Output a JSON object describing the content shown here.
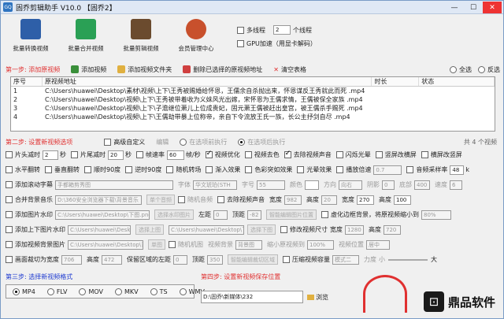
{
  "window": {
    "title": "固乔剪辑助手 V10.0 【固乔2】"
  },
  "toolbar": {
    "items": [
      {
        "label": "批量转换视频",
        "icon": "convert-video-icon",
        "color": "#2e5fa8"
      },
      {
        "label": "批量合并视频",
        "icon": "merge-video-icon",
        "color": "#2aa055"
      },
      {
        "label": "批量剪辑视频",
        "icon": "edit-video-icon",
        "color": "#6b4b2e"
      },
      {
        "label": "会员管理中心",
        "icon": "member-center-icon",
        "color": "#c8502c"
      }
    ],
    "multithread_label": "多线程",
    "multithread_value": "2",
    "threads_suffix": "个线程",
    "gpu_label": "GPU加速",
    "gpu_hint": "（用显卡解码）"
  },
  "step1": {
    "title": "第一步: 添加原视频",
    "add_video": "添加视频",
    "add_folder": "添加视频文件夹",
    "delete_selected": "删除已选择的原视频地址",
    "clear_table": "清空表格",
    "select_all": "全选",
    "invert": "反选"
  },
  "table": {
    "headers": [
      "序号",
      "原视频地址",
      "时长",
      "状态"
    ],
    "rows": [
      {
        "no": "1",
        "path": "C:\\Users\\huawei\\Desktop\\素材\\视频\\上下\\王秀被赐婚给怀恩，王儒余自杀抛出来，怀恩谋反王秀就此而死 .mp4"
      },
      {
        "no": "2",
        "path": "C:\\Users\\huawei\\Desktop\\视频\\上下\\王秀被带着收为义妹风光出嫁，宋怀恩为王儒求情，王儒被保全家族 .mp4"
      },
      {
        "no": "3",
        "path": "C:\\Users\\huawei\\Desktop\\视频\\上下\\子澹继位萧儿上位成贵妃，固元萧王儒被赶出皇宫，被王儒杀手赐死 .mp4"
      },
      {
        "no": "4",
        "path": "C:\\Users\\huawei\\Desktop\\视频\\上下\\王儒劫带暴上位称帝，亲自下令流放王氏一族，长公主抒剑自尽 .mp4"
      }
    ]
  },
  "step2": {
    "title": "第二步: 设置新视频选项",
    "adv_custom": "高级自定义",
    "edit": "编辑",
    "mode_before": "在选项前执行",
    "mode_after": "在选项后执行",
    "count": "共 4 个视频"
  },
  "settings": {
    "r1": {
      "trim_head": "片头减时",
      "trim_head_val": "2",
      "sec": "秒",
      "trim_tail": "片尾减时",
      "trim_tail_val": "20",
      "sec2": "秒",
      "frame_rate": "帧速率",
      "frame_rate_val": "60",
      "fps": "帧/秒",
      "optimize": "视频优化",
      "remove_color": "视频去色",
      "remove_audio": "去除视频声音",
      "flash": "闪烁光晕",
      "vertical_blur": "竖屏改横屏",
      "horizontal_blur": "横屏改竖屏"
    },
    "r2": {
      "hflip": "水平翻转",
      "vflip": "垂直翻转",
      "rot_cw": "顺时90度",
      "rot_ccw": "逆时90度",
      "random_transition": "随机转场",
      "fade_in": "渐入效果",
      "color_random": "色彩突如效果",
      "light_fx": "光晕效果",
      "speed": "播放倍速",
      "speed_val": "0.7",
      "audio_rate": "音频采样率",
      "audio_rate_val": "48",
      "k": "k"
    },
    "r3": {
      "scroll_sub": "添加滚动字幕",
      "scroll_text": "手都箱剪秀图",
      "font": "字体",
      "font_val": "华文琥珀(STH",
      "size": "字号",
      "size_val": "55",
      "color": "颜色",
      "direction": "方向",
      "dir_val": "向右",
      "shadow": "阴影",
      "shadow_val": "0",
      "bottom": "底部",
      "bottom_val": "400",
      "speed": "速度",
      "speed_val": "6"
    },
    "r4": {
      "merge_music": "合并背景音乐",
      "music_path": "D:\\360安全浏览器下载\\背景音乐",
      "add_music": "单个音频",
      "random_music": "随机音频",
      "remove_audio2": "去除视频声音",
      "width": "宽度",
      "width_val": "982",
      "height": "高度",
      "height_val": "20",
      "w2": "宽度",
      "w2_val": "270",
      "h2": "高度",
      "h2_val": "100"
    },
    "r5": {
      "watermark": "添加图片水印",
      "wm_path": "C:\\Users\\huawei\\Desktop\\下图.png",
      "select_wm": "选择水印图片",
      "left": "左距",
      "left_val": "0",
      "top": "顶距",
      "top_val": "-82",
      "smart_wm": "智能编辑图片位置",
      "blur_bg": "虚化边框背景，将原视频缩小到",
      "scale_val": "80%"
    },
    "r6": {
      "add_topbottom": "添加上下图片水印",
      "tb_path": "C:\\Users\\huawei\\Desktop\\上图.png",
      "select_top": "选择上图",
      "tb_path2": "C:\\Users\\huawei\\Desktop\\下图.png",
      "select_bottom": "选择下图",
      "modify_size": "修改视频尺寸",
      "width": "宽度",
      "width_val": "1280",
      "height": "高度",
      "height_val": "720"
    },
    "r7": {
      "add_bg": "添加视频背景图片",
      "bg_path": "C:\\Users\\huawei\\Desktop\\背景图",
      "single_img": "单图",
      "random_img": "随机机图",
      "bg_color": "视频背景",
      "bg_color_val": "背景图",
      "shrink": "缩小原视频到",
      "shrink_val": "100%",
      "pos": "视频位置",
      "pos_val": "居中"
    },
    "r8": {
      "crop": "画面裁切为宽度",
      "crop_w": "706",
      "crop_h_lbl": "高度",
      "crop_h": "472",
      "keep": "保留区域的左距",
      "left_val": "0",
      "top_lbl": "顶距",
      "top_val": "350",
      "smart_crop": "智能编辑裁切区域",
      "compress": "压缩视频容量",
      "mode_val": "模式二",
      "force": "力度",
      "small": "小",
      "big": "大"
    }
  },
  "step3": {
    "title": "第三步: 选择新视频格式",
    "formats": [
      "MP4",
      "FLV",
      "MOV",
      "MKV",
      "TS",
      "WMV"
    ]
  },
  "step4": {
    "title": "第四步: 设置新视频保存位置",
    "path": "D:\\固乔\\新媒体\\232",
    "browse": "浏览"
  },
  "watermark_brand": "鼎品软件",
  "colors": {
    "accent_red": "#e03030",
    "step_blue": "#1f3bd0",
    "title_bar": "#dfe8f5"
  }
}
